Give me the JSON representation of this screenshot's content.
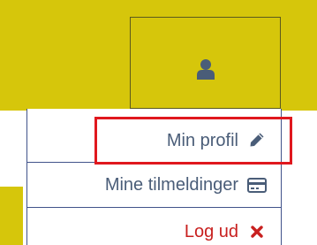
{
  "colors": {
    "header_background": "#d6c60b",
    "menu_text": "#4a5d78",
    "logout_text": "#c8201f",
    "highlight_border": "#e0181e",
    "menu_border": "#41538a"
  },
  "user_button": {
    "icon": "user-icon"
  },
  "menu": {
    "items": [
      {
        "label": "Min profil",
        "icon": "pencil-icon"
      },
      {
        "label": "Mine tilmeldinger",
        "icon": "credit-card-icon"
      },
      {
        "label": "Log ud",
        "icon": "close-icon"
      }
    ]
  }
}
